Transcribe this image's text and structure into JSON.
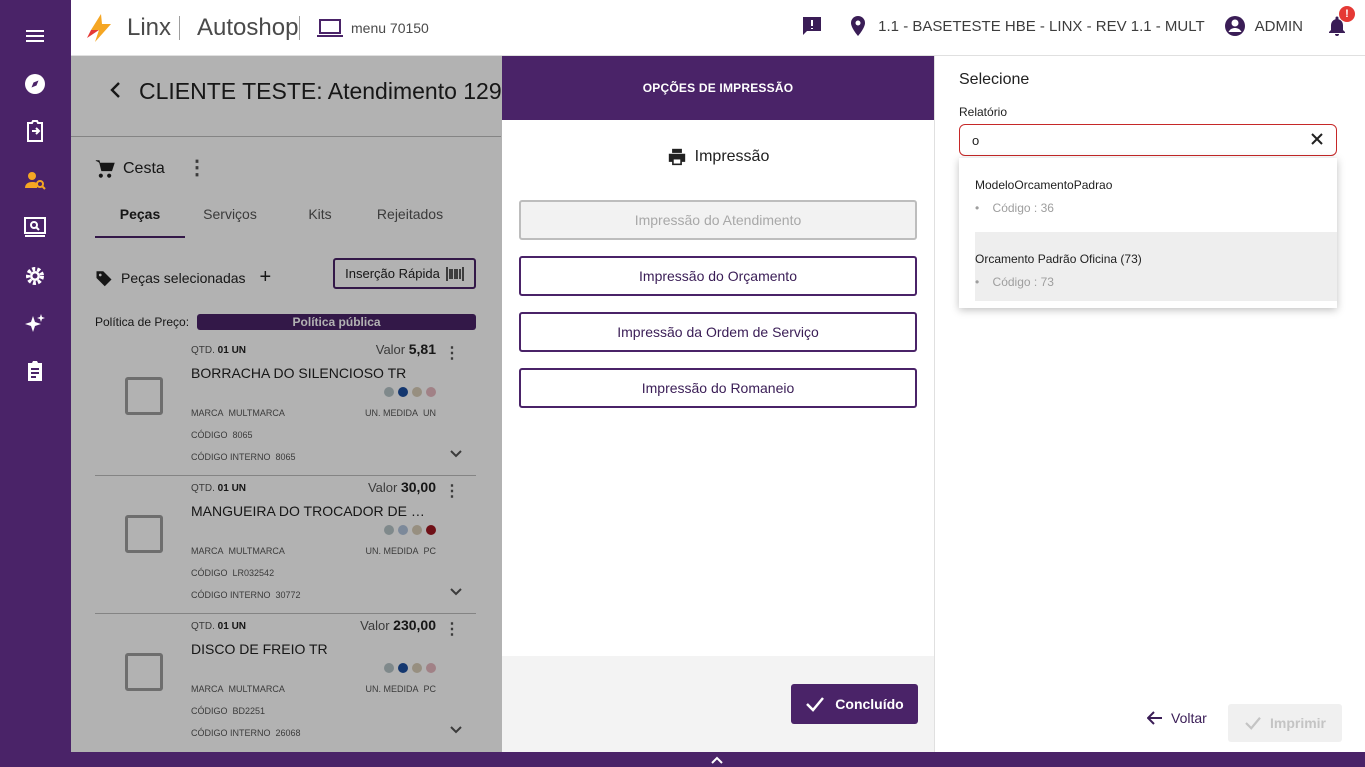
{
  "topbar": {
    "brand": "Linx",
    "app_name": "Autoshop",
    "menu_label": "menu 70150",
    "location": "1.1 - BASETESTE HBE - LINX - REV 1.1 - MULT",
    "user": "ADMIN",
    "notification_badge": "!"
  },
  "page": {
    "title": "CLIENTE TESTE: Atendimento 129",
    "cesta": "Cesta",
    "tabs": [
      "Peças",
      "Serviços",
      "Kits",
      "Rejeitados"
    ],
    "pecas_selecionadas": "Peças selecionadas",
    "insercao_rapida": "Inserção Rápida",
    "politica_label": "Política de Preço:",
    "politica_value": "Política pública",
    "items": [
      {
        "qtd_label": "QTD.",
        "qtd": "01 UN",
        "valor_label": "Valor",
        "valor": "5,81",
        "name": "BORRACHA DO SILENCIOSO TR",
        "marca_label": "MARCA",
        "marca": "MULTMARCA",
        "unm_label": "UN. MEDIDA",
        "unm": "UN",
        "cod_label": "CÓDIGO",
        "cod": "8065",
        "codi_label": "CÓDIGO INTERNO",
        "codi": "8065",
        "swatches": [
          "#b7c4c8",
          "#1e4fa0",
          "#d9cdb8",
          "#e7b9c0"
        ]
      },
      {
        "qtd_label": "QTD.",
        "qtd": "01 UN",
        "valor_label": "Valor",
        "valor": "30,00",
        "name": "MANGUEIRA DO TROCADOR DE CALOR",
        "marca_label": "MARCA",
        "marca": "MULTMARCA",
        "unm_label": "UN. MEDIDA",
        "unm": "PC",
        "cod_label": "CÓDIGO",
        "cod": "LR032542",
        "codi_label": "CÓDIGO INTERNO",
        "codi": "30772",
        "swatches": [
          "#b7c4c8",
          "#b2c4dd",
          "#d9cdb8",
          "#a01822"
        ]
      },
      {
        "qtd_label": "QTD.",
        "qtd": "01 UN",
        "valor_label": "Valor",
        "valor": "230,00",
        "name": "DISCO DE FREIO TR",
        "marca_label": "MARCA",
        "marca": "MULTMARCA",
        "unm_label": "UN. MEDIDA",
        "unm": "PC",
        "cod_label": "CÓDIGO",
        "cod": "BD2251",
        "codi_label": "CÓDIGO INTERNO",
        "codi": "26068",
        "swatches": [
          "#b7c4c8",
          "#1e4fa0",
          "#d9cdb8",
          "#e7b9c0"
        ]
      }
    ]
  },
  "modal": {
    "header": "OPÇÕES DE IMPRESSÃO",
    "subtitle": "Impressão",
    "buttons": [
      {
        "label": "Impressão do Atendimento",
        "disabled": true
      },
      {
        "label": "Impressão do Orçamento",
        "disabled": false
      },
      {
        "label": "Impressão da Ordem de Serviço",
        "disabled": false
      },
      {
        "label": "Impressão do Romaneio",
        "disabled": false
      }
    ],
    "done_label": "Concluído"
  },
  "panel": {
    "title": "Selecione",
    "field_label": "Relatório",
    "field_value": "o",
    "options": [
      {
        "name": "ModeloOrcamentoPadrao",
        "code": "Código : 36"
      },
      {
        "name": "Orcamento Padrão Oficina (73)",
        "code": "Código : 73"
      }
    ],
    "back_label": "Voltar",
    "print_label": "Imprimir"
  },
  "colors": {
    "primary": "#4a2368",
    "accent_orange": "#f5a623",
    "error": "#c62828"
  }
}
